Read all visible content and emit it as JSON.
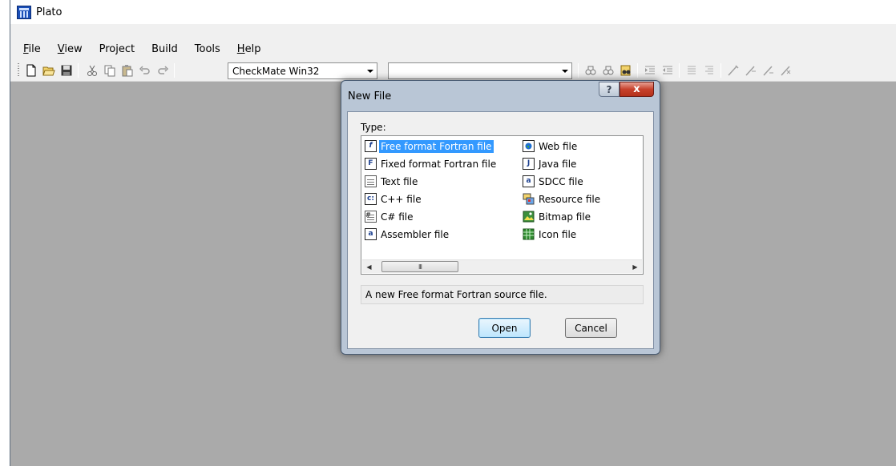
{
  "window": {
    "title": "Plato"
  },
  "menu": [
    {
      "pre": "",
      "u": "F",
      "post": "ile"
    },
    {
      "pre": "",
      "u": "V",
      "post": "iew"
    },
    {
      "pre": "Project",
      "u": "",
      "post": ""
    },
    {
      "pre": "Build",
      "u": "",
      "post": ""
    },
    {
      "pre": "Tools",
      "u": "",
      "post": ""
    },
    {
      "pre": "",
      "u": "H",
      "post": "elp"
    }
  ],
  "toolbar": {
    "config_combo": "CheckMate Win32",
    "platform_combo": ""
  },
  "dialog": {
    "title": "New File",
    "help_glyph": "?",
    "close_glyph": "x",
    "type_label": "Type:",
    "items": [
      {
        "label": "Free format Fortran file",
        "icon": "f",
        "selected": true
      },
      {
        "label": "Fixed format Fortran file",
        "icon": "F"
      },
      {
        "label": "Text file",
        "icon": ""
      },
      {
        "label": "C++ file",
        "icon": "c"
      },
      {
        "label": "C# file",
        "icon": "#"
      },
      {
        "label": "Assembler file",
        "icon": "a"
      },
      {
        "label": "Web file",
        "icon": "web"
      },
      {
        "label": "Java file",
        "icon": "J"
      },
      {
        "label": "SDCC file",
        "icon": "a"
      },
      {
        "label": "Resource file",
        "icon": "res"
      },
      {
        "label": "Bitmap file",
        "icon": "bmp"
      },
      {
        "label": "Icon file",
        "icon": "ico"
      }
    ],
    "scroll_thumb": "III",
    "description": "A new Free format Fortran source file.",
    "open_label": "Open",
    "cancel_label": "Cancel"
  }
}
